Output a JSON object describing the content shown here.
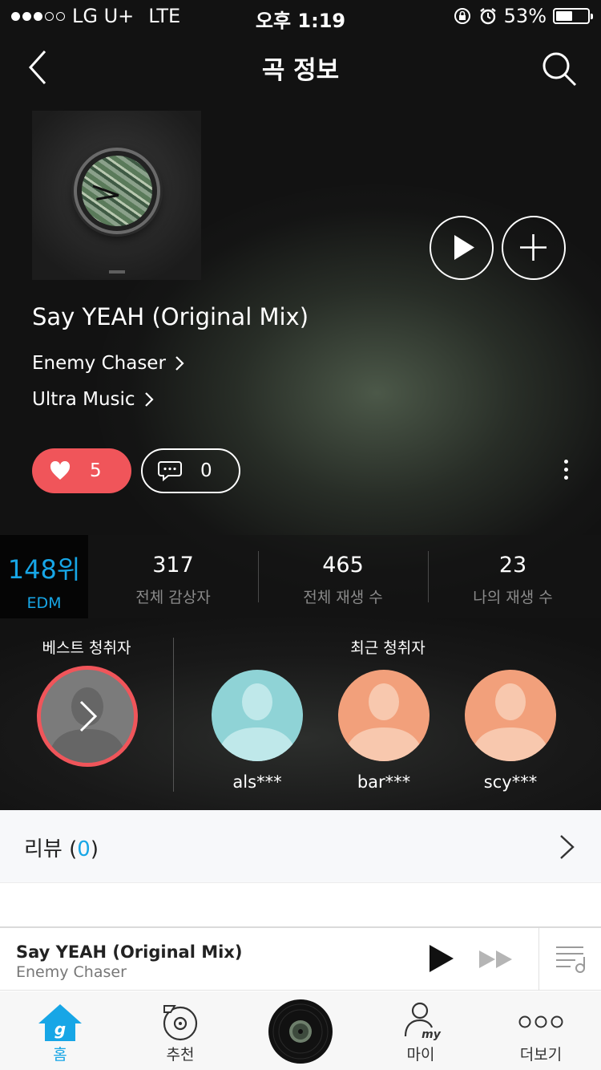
{
  "status_bar": {
    "carrier": "LG U+",
    "network": "LTE",
    "time": "오후 1:19",
    "battery": "53%",
    "battery_level": 0.53
  },
  "nav": {
    "title": "곡 정보"
  },
  "song": {
    "title": "Say YEAH (Original Mix)",
    "artist": "Enemy Chaser",
    "label": "Ultra Music"
  },
  "actions": {
    "likes": "5",
    "comments": "0"
  },
  "stats": {
    "rank": "148위",
    "genre": "EDM",
    "listeners": {
      "value": "317",
      "label": "전체 감상자"
    },
    "plays": {
      "value": "465",
      "label": "전체 재생 수"
    },
    "my_plays": {
      "value": "23",
      "label": "나의 재생 수"
    }
  },
  "listeners": {
    "best_header": "베스트 청취자",
    "recent_header": "최근 청취자",
    "recent": [
      {
        "name": "als***",
        "color": "#8fd3d6"
      },
      {
        "name": "bar***",
        "color": "#f2a07b"
      },
      {
        "name": "scy***",
        "color": "#f2a07b"
      }
    ]
  },
  "review": {
    "label": "리뷰",
    "open_paren": "(",
    "count": "0",
    "close_paren": ")"
  },
  "mini_player": {
    "title": "Say YEAH (Original Mix)",
    "artist": "Enemy Chaser"
  },
  "tabs": [
    {
      "label": "홈",
      "icon": "home-icon",
      "active": true
    },
    {
      "label": "추천",
      "icon": "recommend-icon",
      "active": false
    },
    {
      "label": "",
      "icon": "now-playing-disc-icon",
      "active": false
    },
    {
      "label": "마이",
      "icon": "my-icon",
      "active": false
    },
    {
      "label": "더보기",
      "icon": "more-icon",
      "active": false
    }
  ],
  "colors": {
    "accent_blue": "#17a6e6",
    "like_red": "#f0555a"
  }
}
